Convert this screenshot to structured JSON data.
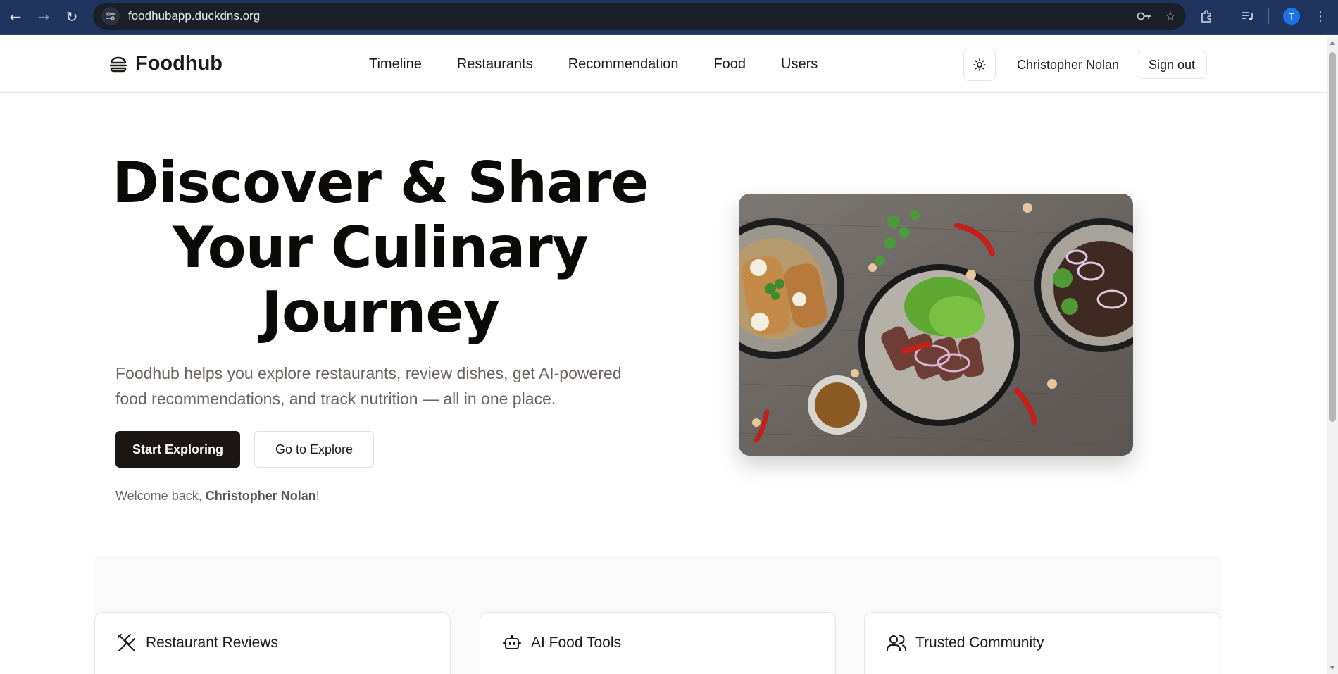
{
  "browser": {
    "url": "foodhubapp.duckdns.org",
    "profile_initial": "T",
    "icons": [
      "back-arrow-icon",
      "forward-arrow-icon",
      "reload-icon",
      "site-info-icon",
      "password-key-icon",
      "bookmark-star-icon",
      "extensions-icon",
      "media-queue-icon",
      "kebab-menu-icon"
    ]
  },
  "header": {
    "brand": "Foodhub",
    "nav": [
      "Timeline",
      "Restaurants",
      "Recommendation",
      "Food",
      "Users"
    ],
    "user_name": "Christopher Nolan",
    "sign_out": "Sign out"
  },
  "hero": {
    "title_line1": "Discover & Share",
    "title_line2": "Your Culinary",
    "title_line3": "Journey",
    "description": "Foodhub helps you explore restaurants, review dishes, get AI-powered food recommendations, and track nutrition — all in one place.",
    "primary_cta": "Start Exploring",
    "secondary_cta": "Go to Explore",
    "welcome_prefix": "Welcome back, ",
    "welcome_name": "Christopher Nolan",
    "welcome_suffix": "!"
  },
  "features": [
    {
      "title": "Restaurant Reviews",
      "icon": "utensils-crossed-icon"
    },
    {
      "title": "AI Food Tools",
      "icon": "bot-icon"
    },
    {
      "title": "Trusted Community",
      "icon": "users-icon"
    }
  ],
  "colors": {
    "chrome_bg": "#1f3560",
    "primary_button": "#1c1714",
    "muted_text": "#6b6360"
  }
}
